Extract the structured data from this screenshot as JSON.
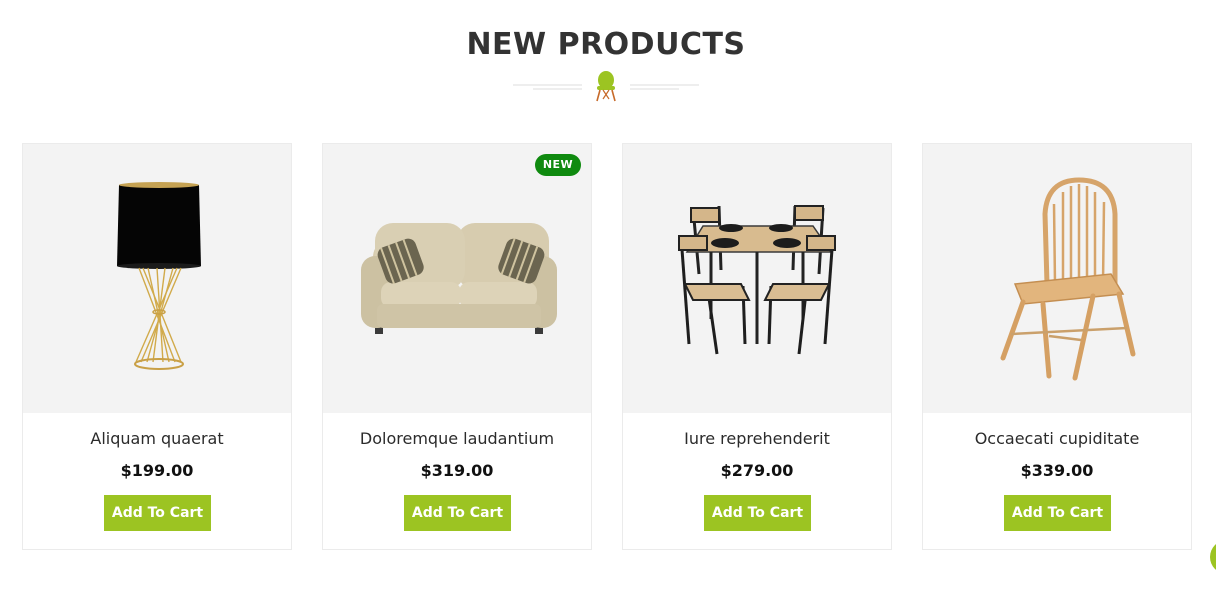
{
  "section": {
    "title": "NEW PRODUCTS",
    "divider_icon": "chair-icon"
  },
  "colors": {
    "accent": "#9cc422",
    "badge": "#0f8a0f",
    "image_bg": "#f3f3f3",
    "title": "#333333"
  },
  "products": [
    {
      "name": "Aliquam quaerat",
      "price": "$199.00",
      "button": "Add To Cart",
      "image": "table-lamp-image"
    },
    {
      "name": "Doloremque laudantium",
      "price": "$319.00",
      "button": "Add To Cart",
      "image": "sofa-image",
      "badge": "NEW"
    },
    {
      "name": "Iure reprehenderit",
      "price": "$279.00",
      "button": "Add To Cart",
      "image": "dining-set-image"
    },
    {
      "name": "Occaecati cupiditate",
      "price": "$339.00",
      "button": "Add To Cart",
      "image": "windsor-chair-image"
    }
  ]
}
